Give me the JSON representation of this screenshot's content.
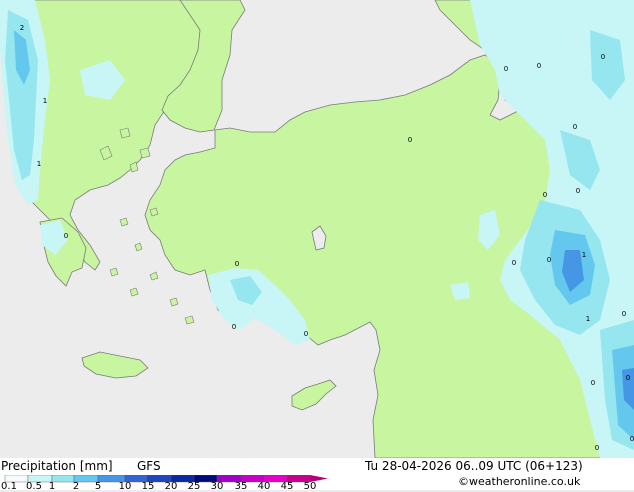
{
  "map": {
    "colors": {
      "sea": "#ececec",
      "land": "#c8f5a0",
      "precip_0_1": "#c8f5f5",
      "precip_0_5": "#96e6f0",
      "precip_1": "#64c8ee",
      "precip_2": "#4696e6",
      "coast": "#7a7a7a"
    },
    "contour_labels": [
      {
        "text": "2"
      },
      {
        "text": "1"
      },
      {
        "text": "1"
      },
      {
        "text": "0"
      },
      {
        "text": "0"
      },
      {
        "text": "0"
      },
      {
        "text": "0"
      },
      {
        "text": "0"
      },
      {
        "text": "0"
      },
      {
        "text": "0"
      },
      {
        "text": "0"
      },
      {
        "text": "0"
      },
      {
        "text": "0"
      },
      {
        "text": "0"
      },
      {
        "text": "0"
      },
      {
        "text": "0"
      },
      {
        "text": "1"
      },
      {
        "text": "1"
      },
      {
        "text": "0"
      },
      {
        "text": "0"
      },
      {
        "text": "0"
      },
      {
        "text": "0"
      },
      {
        "text": "0"
      }
    ]
  },
  "legend": {
    "title": "Precipitation [mm]",
    "model": "GFS",
    "ticks": [
      "0.1",
      "0.5",
      "1",
      "2",
      "5",
      "10",
      "15",
      "20",
      "25",
      "30",
      "35",
      "40",
      "45",
      "50"
    ],
    "colors": [
      "#f5fcfe",
      "#c8f5f5",
      "#96e6f0",
      "#64c8ee",
      "#4696e6",
      "#3264d2",
      "#1e46be",
      "#0a28a0",
      "#000a78",
      "#a000c8",
      "#c800c8",
      "#e600c8",
      "#c8008c",
      "#b40078"
    ]
  },
  "valid_time": "Tu 28-04-2026 06..09 UTC (06+123)",
  "credit": "©weatheronline.co.uk"
}
